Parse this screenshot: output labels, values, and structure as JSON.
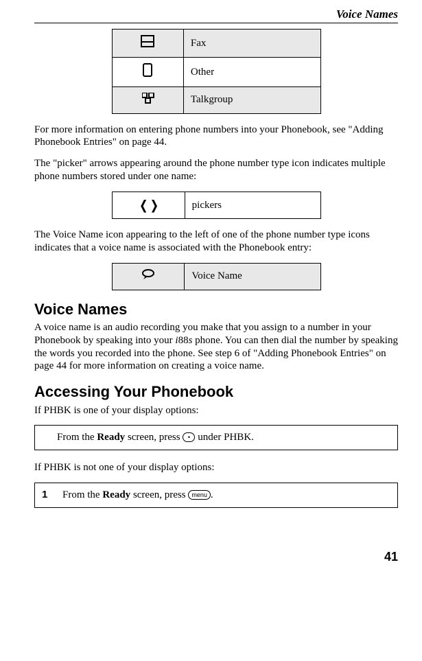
{
  "header": {
    "title": "Voice Names"
  },
  "iconTable1": {
    "rows": [
      {
        "icon": "fax-icon",
        "label": "Fax",
        "shaded": true
      },
      {
        "icon": "other-icon",
        "label": "Other",
        "shaded": false
      },
      {
        "icon": "talkgroup-icon",
        "label": "Talkgroup",
        "shaded": true
      }
    ]
  },
  "para1a": "For more information on entering phone numbers into your Phonebook, see ",
  "para1b": "\"Adding Phonebook Entries\" on page 44.",
  "para2": "The \"picker\" arrows appearing around the phone number type icon indicates multiple phone numbers stored under one name:",
  "pickerTable": {
    "label": "pickers"
  },
  "para3": "The Voice Name icon appearing to the left of one of the phone number type icons indicates that a voice name is associated with the Phonebook entry:",
  "voiceTable": {
    "label": "Voice Name"
  },
  "h_voice": "Voice Names",
  "para4_a": "A voice name is an audio recording you make that you assign to a number in your Phonebook by speaking into your ",
  "para4_i": "i",
  "para4_88": "88",
  "para4_s": "s",
  "para4_b": " phone. You can then dial the number by speaking the words you recorded into the phone. See step 6 of \"Adding Phonebook Entries\" on page 44 for more information on creating a voice name.",
  "h_access": "Accessing Your Phonebook",
  "para5": "If PHBK is one of your display options:",
  "step1_a": "From the ",
  "step1_bold": "Ready",
  "step1_b": " screen, press ",
  "step1_c": " under PHBK.",
  "para6": "If PHBK is not one of your display options:",
  "step2_num": "1",
  "step2_a": "From the ",
  "step2_bold": "Ready",
  "step2_b": " screen, press ",
  "step2_key": "menu",
  "step2_c": ".",
  "pageNum": "41"
}
